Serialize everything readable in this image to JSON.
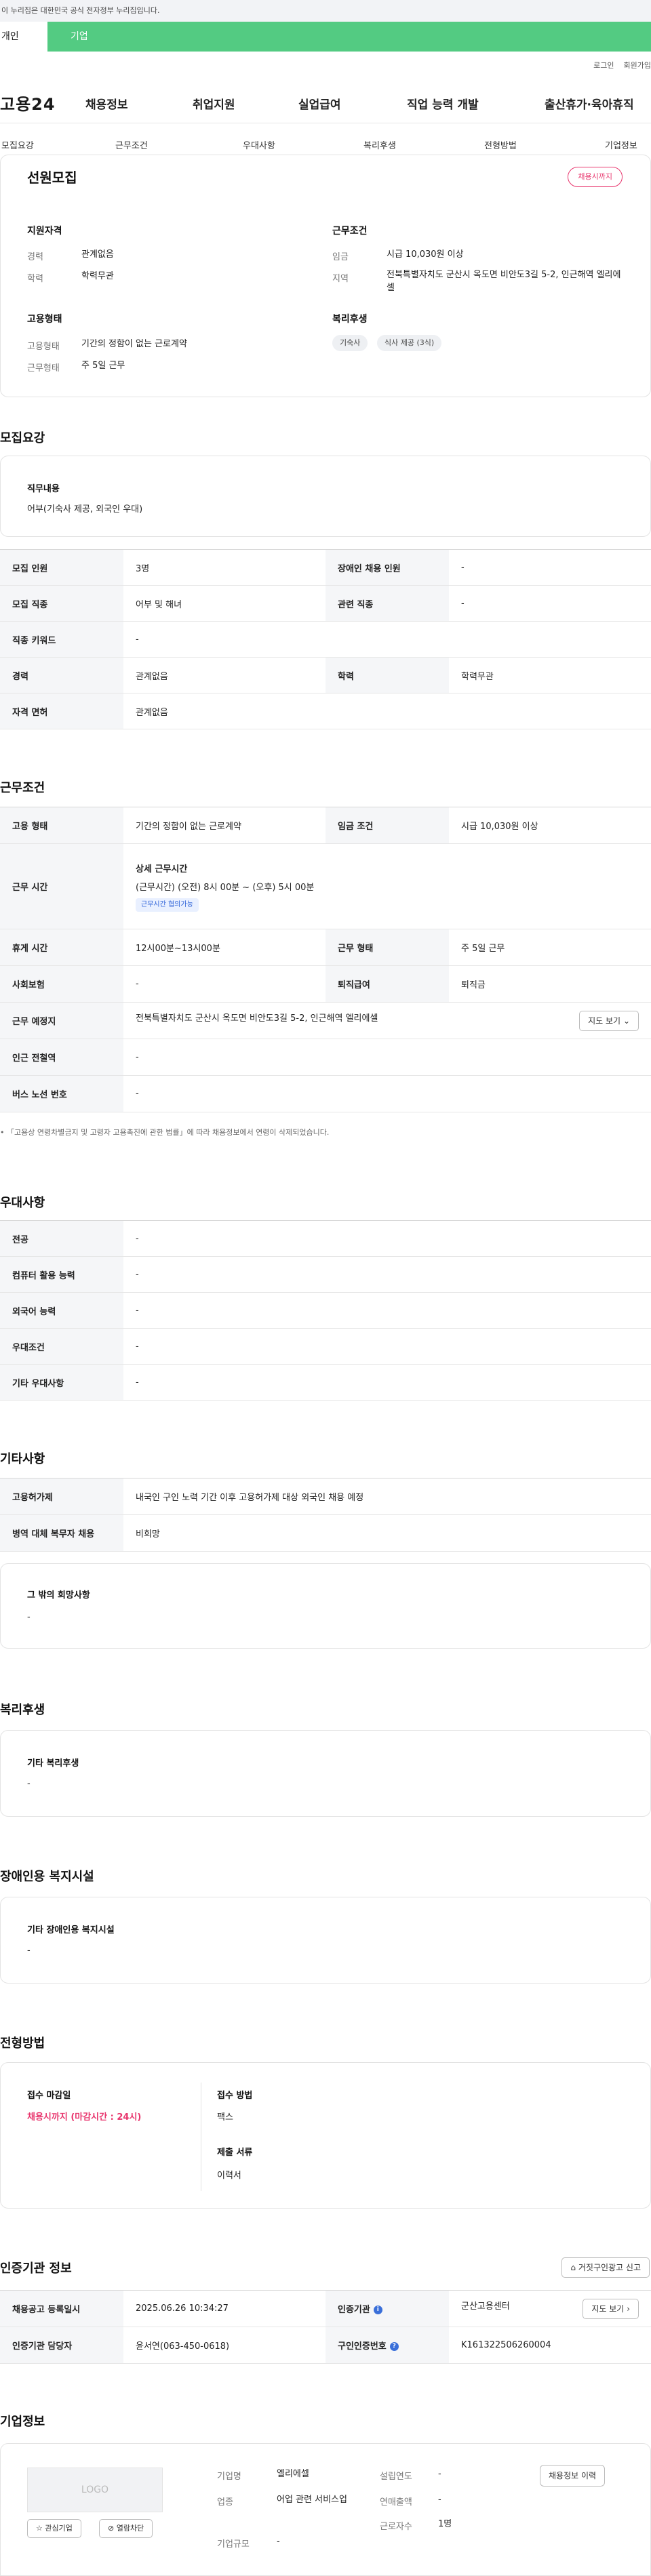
{
  "gov_bar": {
    "text": "이 누리집은 대한민국 공식 전자정부 누리집입니다."
  },
  "user_tabs": {
    "first": "개인",
    "second": "기업"
  },
  "top_links": [
    "로그인",
    "회원가입"
  ],
  "logo": "고용24",
  "gnb": [
    "채용정보",
    "취업지원",
    "실업급여",
    "직업 능력 개발",
    "출산휴가·육아휴직"
  ],
  "subnav": [
    "모집요강",
    "근무조건",
    "우대사항",
    "복리후생",
    "전형방법",
    "기업정보"
  ],
  "summary": {
    "title": "선원모집",
    "status": "채용시까지",
    "qualification": {
      "title": "지원자격",
      "rows": [
        {
          "label": "경력",
          "value": "관계없음"
        },
        {
          "label": "학력",
          "value": "학력무관"
        }
      ]
    },
    "conditions": {
      "title": "근무조건",
      "rows": [
        {
          "label": "임금",
          "value": "시급 10,030원 이상"
        },
        {
          "label": "지역",
          "value": "전북특별자치도 군산시 옥도면 비안도3길 5-2, 인근해역 엘리에셀"
        }
      ]
    },
    "employment": {
      "title": "고용형태",
      "rows": [
        {
          "label": "고용형태",
          "value": "기간의 정함이 없는 근로계약"
        },
        {
          "label": "근무형태",
          "value": "주 5일 근무"
        }
      ]
    },
    "welfare": {
      "title": "복리후생",
      "tags": [
        "기숙사",
        "식사 제공 (3식)"
      ]
    }
  },
  "recruit": {
    "section_title": "모집요강",
    "duty_title": "직무내용",
    "duty_text": "어부(기숙사 제공, 외국인 우대)",
    "rows": [
      {
        "h1": "모집 인원",
        "v1": "3명",
        "h2": "장애인 채용 인원",
        "v2": "-"
      },
      {
        "h1": "모집 직종",
        "v1": "어부 및 해녀",
        "h2": "관련 직종",
        "v2": "-"
      },
      {
        "h1": "직종 키워드",
        "v1": "-"
      },
      {
        "h1": "경력",
        "v1": "관계없음",
        "h2": "학력",
        "v2": "학력무관"
      },
      {
        "h1": "자격 면허",
        "v1": "관계없음"
      }
    ]
  },
  "work": {
    "section_title": "근무조건",
    "employment_label": "고용 형태",
    "employment_value": "기간의 정함이 없는 근로계약",
    "wage_label": "임금 조건",
    "wage_value": "시급 10,030원 이상",
    "hours_label": "근무 시간",
    "hours_title": "상세 근무시간",
    "hours_value": "(근무시간) (오전) 8시 00분 ~ (오후) 5시 00분",
    "hours_badge": "근무시간 협의가능",
    "break_label": "휴게 시간",
    "break_value": "12시00분~13시00분",
    "form_label": "근무 형태",
    "form_value": "주 5일 근무",
    "insurance_label": "사회보험",
    "insurance_value": "-",
    "severance_label": "퇴직급여",
    "severance_value": "퇴직금",
    "place_label": "근무 예정지",
    "place_value": "전북특별자치도 군산시 옥도면 비안도3길 5-2, 인근해역 엘리에셀",
    "map_button": "지도 보기",
    "subway_label": "인근 전철역",
    "subway_value": "-",
    "bus_label": "버스 노선 번호",
    "bus_value": "-",
    "note": "「고용상 연령차별금지 및 고령자 고용촉진에 관한 법률」에 따라 채용정보에서 연령이 삭제되었습니다."
  },
  "preference": {
    "section_title": "우대사항",
    "rows": [
      {
        "h": "전공",
        "v": "-"
      },
      {
        "h": "컴퓨터 활용 능력",
        "v": "-"
      },
      {
        "h": "외국어 능력",
        "v": "-"
      },
      {
        "h": "우대조건",
        "v": "-"
      },
      {
        "h": "기타 우대사항",
        "v": "-"
      }
    ]
  },
  "etc": {
    "section_title": "기타사항",
    "rows": [
      {
        "h": "고용허가제",
        "v": "내국인 구인 노력 기간 이후 고용허가제 대상 외국인 채용 예정"
      },
      {
        "h": "병역 대체 복무자 채용",
        "v": "비희망"
      }
    ],
    "other_title": "그 밖의 희망사항",
    "other_value": "-"
  },
  "welfare": {
    "section_title": "복리후생",
    "card_title": "기타 복리후생",
    "card_value": "-"
  },
  "disability": {
    "section_title": "장애인용 복지시설",
    "card_title": "기타 장애인용 복지시설",
    "card_value": "-"
  },
  "process": {
    "section_title": "전형방법",
    "deadline_title": "접수 마감일",
    "deadline_value": "채용시까지 (마감시간 : 24시)",
    "method_title": "접수 방법",
    "method_value": "팩스",
    "docs_title": "제출 서류",
    "docs_value": "이력서"
  },
  "cert": {
    "section_title": "인증기관 정보",
    "report_button": "거짓구인광고 신고",
    "reg_label": "채용공고 등록일시",
    "reg_value": "2025.06.26 10:34:27",
    "org_label": "인증기관",
    "org_value": "군산고용센터",
    "map_button": "지도 보기",
    "manager_label": "인증기관 담당자",
    "manager_value": "윤서연(063-450-0618)",
    "number_label": "구인인증번호",
    "number_value": "K161322506260004"
  },
  "company": {
    "section_title": "기업정보",
    "logo_text": "LOGO",
    "interest_button": "관심기업",
    "block_button": "열람차단",
    "history_button": "채용정보 이력",
    "name_label": "기업명",
    "name_value": "엘리에셀",
    "industry_label": "업종",
    "industry_value": "어업 관련 서비스업",
    "size_label": "기업규모",
    "size_value": "-",
    "founded_label": "설립연도",
    "founded_value": "-",
    "sales_label": "연매출액",
    "sales_value": "-",
    "employees_label": "근로자수",
    "employees_value": "1명"
  }
}
